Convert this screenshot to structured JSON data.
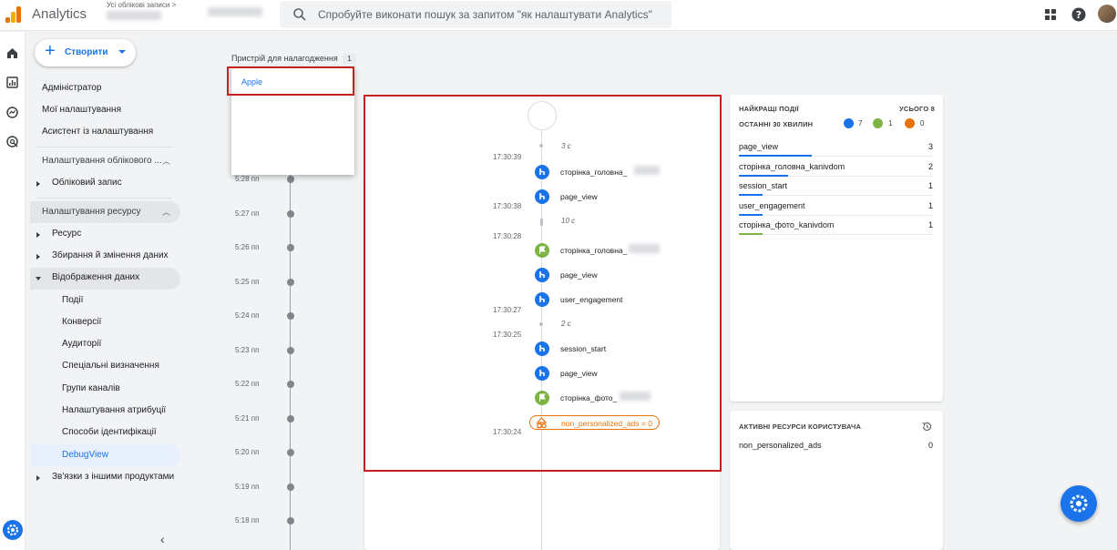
{
  "header": {
    "app_title": "Analytics",
    "account_selector": "Усі облікові записи >",
    "search_placeholder": "Спробуйте виконати пошук за запитом \"як налаштувати Analytics\""
  },
  "nav": {
    "create_label": "Створити",
    "items": [
      {
        "label": "Адміністратор"
      },
      {
        "label": "Мої налаштування"
      },
      {
        "label": "Асистент із налаштування"
      },
      {
        "label": "Налаштування облікового ..."
      },
      {
        "label": "Обліковий запис"
      },
      {
        "label": "Налаштування ресурсу"
      },
      {
        "label": "Ресурс"
      },
      {
        "label": "Збирання й змінення даних"
      },
      {
        "label": "Відображення даних"
      },
      {
        "label": "Події"
      },
      {
        "label": "Конверсії"
      },
      {
        "label": "Аудиторії"
      },
      {
        "label": "Спеціальні визначення"
      },
      {
        "label": "Групи каналів"
      },
      {
        "label": "Налаштування атрибуції"
      },
      {
        "label": "Способи ідентифікації"
      },
      {
        "label": "DebugView"
      },
      {
        "label": "Зв'язки з іншими продуктами"
      }
    ]
  },
  "debug": {
    "device_label": "Пристрій для налагодження",
    "device_count": "1",
    "device_option": "Apple",
    "minutes": [
      "5:28 пп",
      "5:27 пп",
      "5:26 пп",
      "5:25 пп",
      "5:24 пп",
      "5:23 пп",
      "5:22 пп",
      "5:21 пп",
      "5:20 пп",
      "5:19 пп",
      "5:18 пп"
    ]
  },
  "stream": {
    "timestamps": [
      "17:30:39",
      "17:30:38",
      "17:30:28",
      "17:30:27",
      "17:30:25",
      "17:30:24"
    ],
    "gaps": [
      "3 с",
      "10 с",
      "2 с"
    ],
    "events": [
      {
        "name": "сторінка_головна_",
        "icon": "blue"
      },
      {
        "name": "page_view",
        "icon": "blue"
      },
      {
        "name": "сторінка_головна_",
        "icon": "green"
      },
      {
        "name": "page_view",
        "icon": "blue"
      },
      {
        "name": "user_engagement",
        "icon": "blue"
      },
      {
        "name": "session_start",
        "icon": "blue"
      },
      {
        "name": "page_view",
        "icon": "blue"
      },
      {
        "name": "сторінка_фото_",
        "icon": "green"
      }
    ],
    "param_event": "non_personalized_ads = 0"
  },
  "top_events": {
    "title": "НАЙКРАЩІ ПОДІЇ",
    "total": "УСЬОГО 8",
    "period": "ОСТАННІ 30 ХВИЛИН",
    "counts": {
      "blue": "7",
      "green": "1",
      "orange": "0"
    },
    "rows": [
      {
        "name": "page_view",
        "value": "3",
        "fraction": 1.0,
        "color": "#1a73e8"
      },
      {
        "name": "сторінка_головна_kanivdom",
        "value": "2",
        "fraction": 0.67,
        "color": "#1a73e8"
      },
      {
        "name": "session_start",
        "value": "1",
        "fraction": 0.33,
        "color": "#1a73e8"
      },
      {
        "name": "user_engagement",
        "value": "1",
        "fraction": 0.33,
        "color": "#1a73e8"
      },
      {
        "name": "сторінка_фото_kanivdom",
        "value": "1",
        "fraction": 0.33,
        "color": "#7cb342"
      }
    ]
  },
  "user_props": {
    "title": "АКТИВНІ РЕСУРСИ КОРИСТУВАЧА",
    "rows": [
      {
        "name": "non_personalized_ads",
        "value": "0"
      }
    ]
  },
  "colors": {
    "accent": "#1a73e8",
    "conversion": "#7cb342",
    "error": "#e8710a",
    "highlight": "#c5221f"
  }
}
